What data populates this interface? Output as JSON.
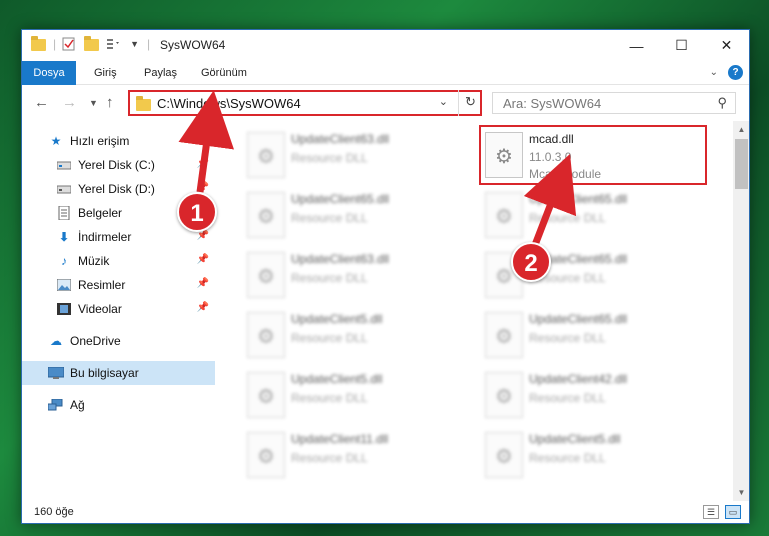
{
  "window": {
    "title": "SysWOW64"
  },
  "ribbon": {
    "tabs": [
      "Dosya",
      "Giriş",
      "Paylaş",
      "Görünüm"
    ],
    "help_label": "?"
  },
  "navbar": {
    "address": "C:\\Windows\\SysWOW64",
    "search_placeholder": "Ara: SysWOW64"
  },
  "sidebar": {
    "items": [
      {
        "label": "Hızlı erişim",
        "icon": "star-icon"
      },
      {
        "label": "Yerel Disk (C:)",
        "icon": "drive-icon"
      },
      {
        "label": "Yerel Disk (D:)",
        "icon": "drive-icon"
      },
      {
        "label": "Belgeler",
        "icon": "documents-icon"
      },
      {
        "label": "İndirmeler",
        "icon": "download-icon"
      },
      {
        "label": "Müzik",
        "icon": "music-icon"
      },
      {
        "label": "Resimler",
        "icon": "pictures-icon"
      },
      {
        "label": "Videolar",
        "icon": "video-icon"
      },
      {
        "label": "OneDrive",
        "icon": "cloud-icon"
      },
      {
        "label": "Bu bilgisayar",
        "icon": "computer-icon"
      },
      {
        "label": "Ağ",
        "icon": "network-icon"
      }
    ]
  },
  "files": {
    "left_column": [
      {
        "name": "UpdateClient63.dll",
        "type": "Resource DLL"
      },
      {
        "name": "UpdateClient65.dll",
        "type": "Resource DLL"
      },
      {
        "name": "UpdateClient63.dll",
        "type": "Resource DLL"
      },
      {
        "name": "UpdateClient5.dll",
        "type": "Resource DLL"
      },
      {
        "name": "UpdateClient5.dll",
        "type": "Resource DLL"
      },
      {
        "name": "UpdateClient11.dll",
        "type": "Resource DLL"
      }
    ],
    "right_column": [
      {
        "name": "mcad.dll",
        "version": "11.0.3.0",
        "description": "Mcad Module"
      },
      {
        "name": "UpdateClient65.dll",
        "type": "Resource DLL"
      },
      {
        "name": "UpdateClient65.dll",
        "type": "Resource DLL"
      },
      {
        "name": "UpdateClient65.dll",
        "type": "Resource DLL"
      },
      {
        "name": "UpdateClient42.dll",
        "type": "Resource DLL"
      },
      {
        "name": "UpdateClient5.dll",
        "type": "Resource DLL"
      }
    ]
  },
  "status": {
    "item_count": "160 öğe"
  },
  "annotations": {
    "marker1": "1",
    "marker2": "2"
  },
  "colors": {
    "accent": "#1979ca",
    "highlight": "#d9262b"
  }
}
